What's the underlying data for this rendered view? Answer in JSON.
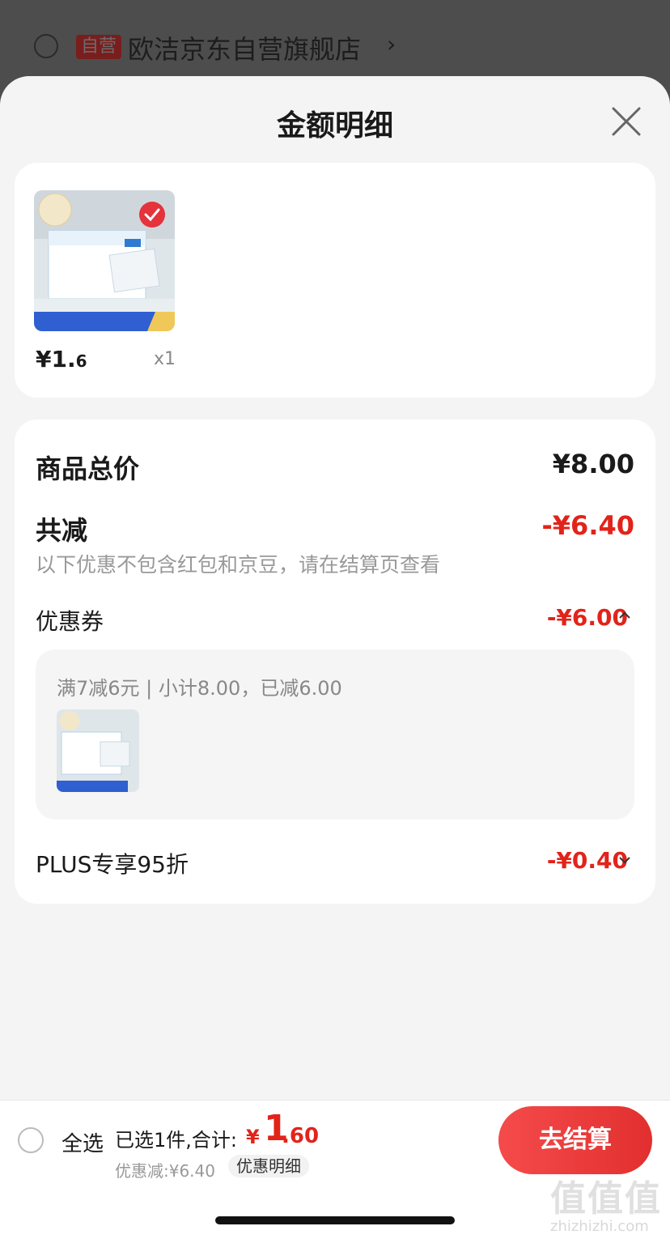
{
  "background": {
    "store_badge": "自营",
    "store_name": "欧洁京东自营旗舰店",
    "chevron": "›"
  },
  "sheet": {
    "title": "金额明细",
    "close_icon": "close-icon"
  },
  "product": {
    "image_icon": "alcohol-cotton-ball-product-image",
    "selected": true,
    "price_main": "¥1.",
    "price_decimal": "6",
    "quantity": "x1"
  },
  "summary": {
    "total_label": "商品总价",
    "total_value": "¥8.00",
    "reduce_label": "共减",
    "reduce_value": "-¥6.40",
    "note": "以下优惠不包含红包和京豆，请在结算页查看",
    "coupon_label": "优惠券",
    "coupon_value": "-¥6.00",
    "coupon_caret": "^",
    "coupon_detail": "满7减6元 | 小计8.00，已减6.00",
    "plus_label": "PLUS专享95折",
    "plus_value": "-¥0.40",
    "plus_caret": "ˇ"
  },
  "bottom_bar": {
    "select_all": "全选",
    "selected_text": "已选1件,合计:",
    "total_yen": "¥",
    "total_int": "1",
    "total_dec": ".60",
    "discount_text": "优惠减:¥6.40",
    "discount_detail_button": "优惠明细",
    "checkout_button": "去结算"
  },
  "watermark": {
    "main": "值值值",
    "url": "zhizhizhi.com"
  },
  "colors": {
    "accent_red": "#e2231a",
    "checkout_gradient_start": "#f54b4b",
    "checkout_gradient_end": "#e22f2f",
    "sheet_bg": "#f4f4f4"
  }
}
